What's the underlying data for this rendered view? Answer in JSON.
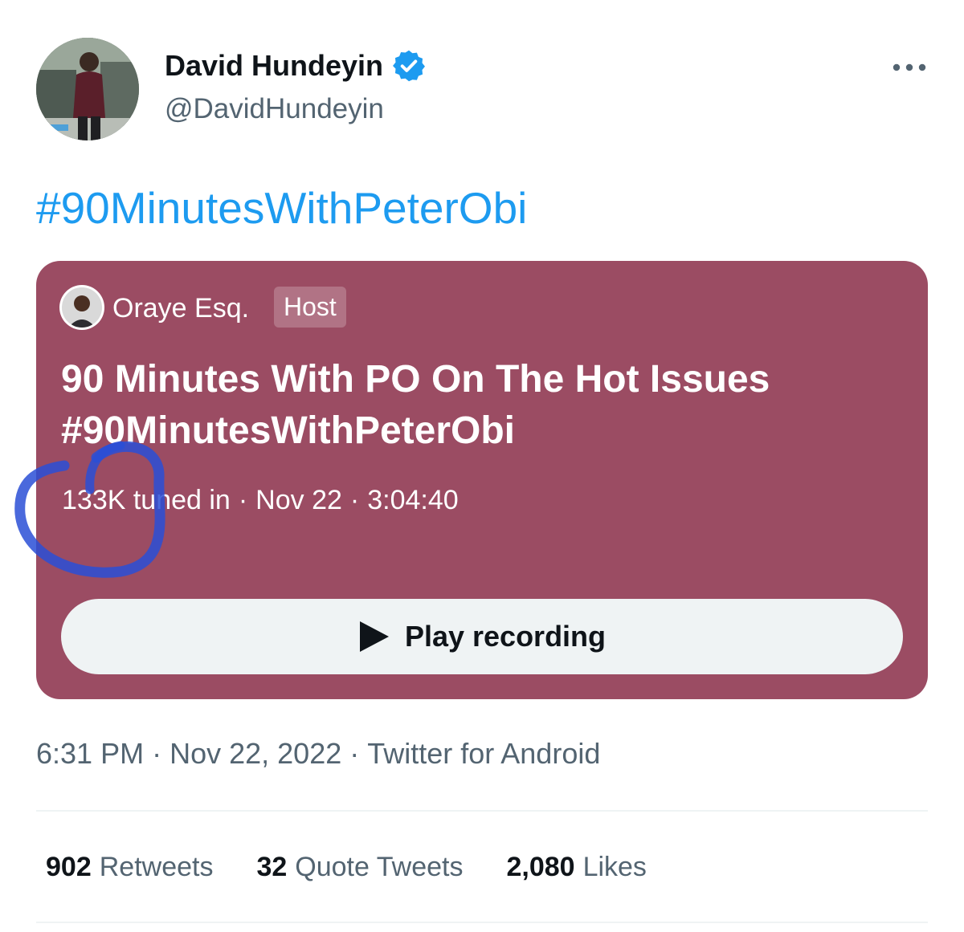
{
  "tweet": {
    "author": {
      "display_name": "David Hundeyin",
      "handle": "@DavidHundeyin",
      "verified_icon": "verified-badge-icon"
    },
    "more_icon": "more-options-icon",
    "text": "#90MinutesWithPeterObi",
    "space": {
      "background_color": "#9b4c63",
      "host_name": "Oraye Esq.",
      "host_badge": "Host",
      "title_line1": "90 Minutes With PO On The Hot Issues",
      "title_line2": "#90MinutesWithPeterObi",
      "tuned_in": "133K tuned in",
      "date": "Nov 22",
      "duration": "3:04:40",
      "separator": "·",
      "play_label": "Play recording",
      "play_icon": "play-icon"
    },
    "timestamp": {
      "time": "6:31 PM",
      "date": "Nov 22, 2022",
      "source": "Twitter for Android",
      "separator": "·"
    },
    "stats": {
      "retweets_count": "902",
      "retweets_label": "Retweets",
      "quotes_count": "32",
      "quotes_label": "Quote Tweets",
      "likes_count": "2,080",
      "likes_label": "Likes"
    }
  },
  "colors": {
    "accent": "#1d9bf0",
    "annotation_stroke": "#2a4fd6",
    "secondary_text": "#536471"
  }
}
